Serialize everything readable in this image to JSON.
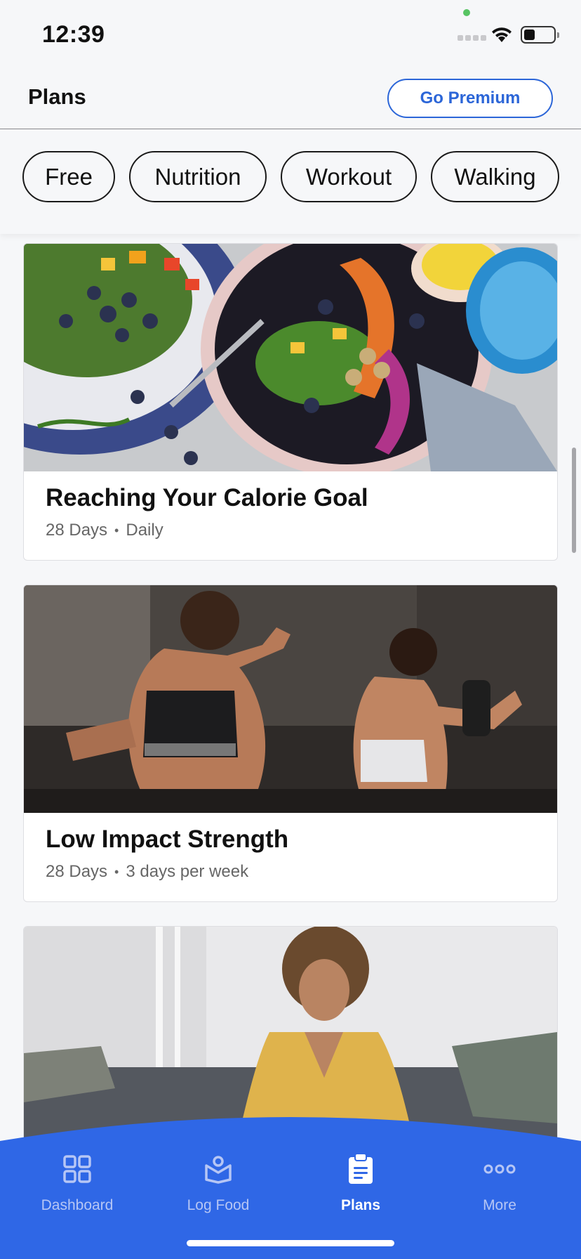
{
  "status_bar": {
    "time": "12:39"
  },
  "header": {
    "title": "Plans",
    "premium_label": "Go Premium"
  },
  "filters": [
    "Free",
    "Nutrition",
    "Workout",
    "Walking"
  ],
  "cards": [
    {
      "title": "Reaching Your Calorie Goal",
      "duration": "28 Days",
      "frequency": "Daily",
      "image": "salad-bowl-photo"
    },
    {
      "title": "Low Impact Strength",
      "duration": "28 Days",
      "frequency": "3 days per week",
      "image": "women-workout-photo"
    },
    {
      "title": "",
      "duration": "",
      "frequency": "",
      "image": "meditation-photo"
    }
  ],
  "tabs": [
    {
      "label": "Dashboard",
      "icon": "grid-icon",
      "active": false
    },
    {
      "label": "Log Food",
      "icon": "log-food-icon",
      "active": false
    },
    {
      "label": "Plans",
      "icon": "clipboard-icon",
      "active": true
    },
    {
      "label": "More",
      "icon": "more-dots-icon",
      "active": false
    }
  ],
  "colors": {
    "accent": "#2c66d8",
    "tabbar": "#2f67e6",
    "background": "#f6f7f9"
  }
}
